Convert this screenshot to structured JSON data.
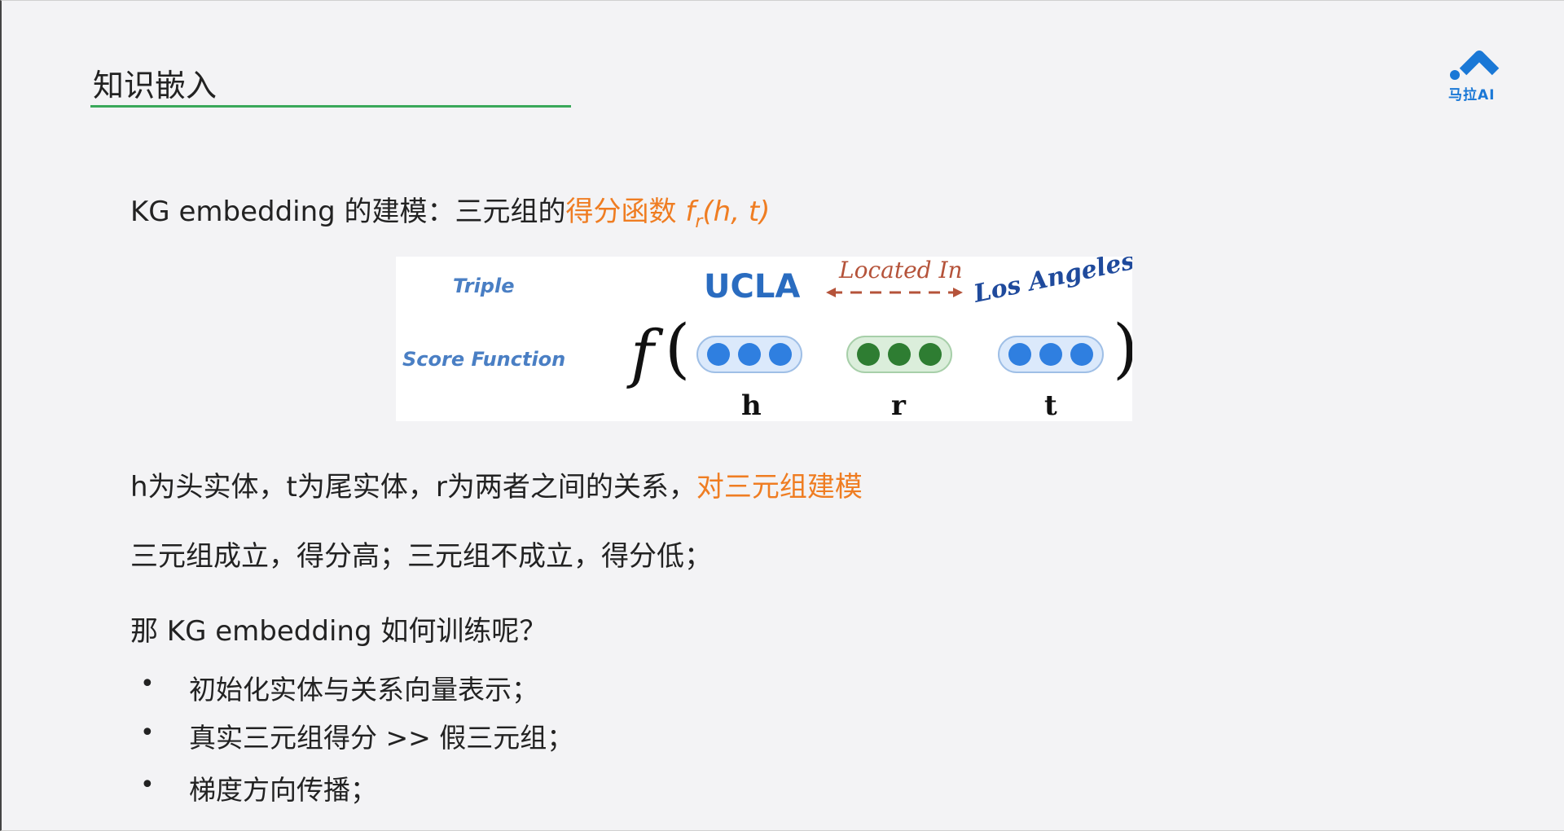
{
  "slide": {
    "title": "知识嵌入",
    "logo_text": "马拉AI",
    "line1_prefix": "KG embedding 的建模：三元组的",
    "line1_highlight": "得分函数",
    "formula_f": "f",
    "formula_sub": "r",
    "formula_args": "(h, t)",
    "figure": {
      "triple_label": "Triple",
      "score_label": "Score Function",
      "head_entity": "UCLA",
      "relation": "Located In",
      "tail_entity": "Los Angeles",
      "func_symbol": "f",
      "h": "h",
      "r": "r",
      "t": "t"
    },
    "line2_prefix": "h为头实体，t为尾实体，r为两者之间的关系，",
    "line2_highlight": "对三元组建模",
    "line3": "三元组成立，得分高；三元组不成立，得分低；",
    "line4": "那 KG embedding 如何训练呢？",
    "bullets": [
      "初始化实体与关系向量表示；",
      "真实三元组得分 >> 假三元组；",
      "梯度方向传播；"
    ]
  },
  "colors": {
    "accent": "#ef7d22",
    "rule": "#3aa85a",
    "brand": "#1a78d6",
    "blue_dot": "#2f7fe0",
    "green_dot": "#2e7d32"
  }
}
